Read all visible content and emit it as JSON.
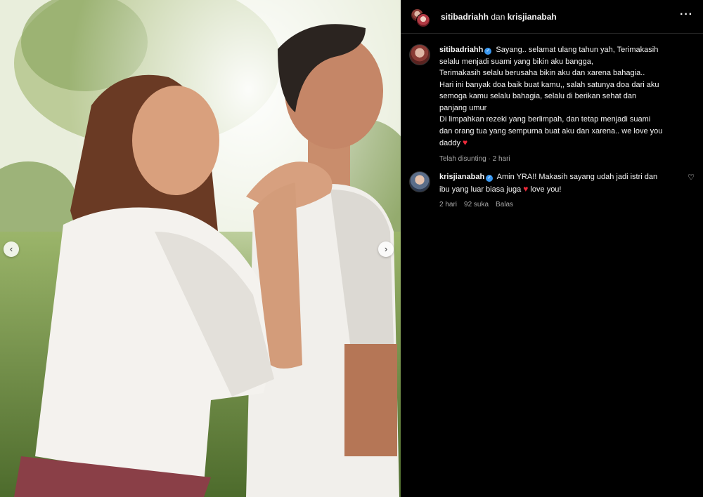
{
  "post": {
    "photo_alt": "Couple laughing outdoors",
    "nav_prev_icon": "chevron-left-icon",
    "nav_next_icon": "chevron-right-icon"
  },
  "header": {
    "user1": "sitibadriahh",
    "joiner": "dan",
    "user2": "krisjianabah",
    "more_icon": "more-horizontal-icon"
  },
  "caption": {
    "username": "sitibadriahh",
    "verified": true,
    "text": "Sayang.. selamat ulang tahun yah, Terimakasih selalu menjadi suami yang bikin aku bangga, Terimakasih selalu berusaha bikin aku dan xarena bahagia.. Hari ini banyak doa baik buat kamu,, salah satunya doa dari aku semoga kamu selalu bahagia, selalu di berikan sehat dan panjang umur Di limpahkan rezeki yang berlimpah, dan tetap menjadi suami dan orang tua yang sempurna buat aku dan xarena.. we love you daddy",
    "lines": [
      "Sayang.. selamat ulang tahun yah, Terimakasih",
      "selalu menjadi suami yang bikin aku bangga,",
      "Terimakasih selalu berusaha bikin aku dan xarena bahagia..",
      "Hari ini banyak doa baik buat kamu,, salah satunya doa dari aku",
      "semoga kamu selalu bahagia, selalu di berikan sehat dan",
      "panjang umur",
      "Di limpahkan rezeki yang berlimpah, dan tetap menjadi suami",
      "dan orang tua yang sempurna buat aku dan xarena.. we love you",
      "daddy"
    ],
    "edited_label": "Telah disunting",
    "separator": "·",
    "time": "2 hari"
  },
  "reply": {
    "username": "krisjianabah",
    "verified": true,
    "line1": "Amin YRA!! Makasih sayang udah jadi istri dan",
    "line2_a": "ibu yang luar biasa juga",
    "line2_b": "love you!",
    "time": "2 hari",
    "likes": "92 suka",
    "reply_label": "Balas"
  },
  "icons": {
    "heart": "♥",
    "like_outline": "♡",
    "verified": "✓",
    "more": "···",
    "prev": "‹",
    "next": "›"
  },
  "colors": {
    "background": "#000000",
    "text": "#f5f5f5",
    "muted": "#a8a8a8",
    "verified": "#3897f0",
    "heart": "#ed2a3a"
  }
}
